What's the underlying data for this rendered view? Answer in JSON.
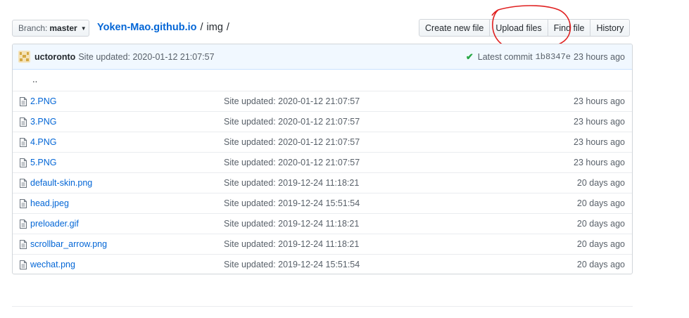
{
  "branch": {
    "label": "Branch:",
    "value": "master"
  },
  "breadcrumb": {
    "repo": "Yoken-Mao.github.io",
    "sep1": "/",
    "folder": "img",
    "sep2": "/"
  },
  "toolbar": {
    "create": "Create new file",
    "upload": "Upload files",
    "find": "Find file",
    "history": "History"
  },
  "commit": {
    "author": "uctoronto",
    "message": "Site updated: 2020-01-12 21:07:57",
    "latest_label": "Latest commit",
    "sha": "1b8347e",
    "age": "23 hours ago"
  },
  "updir": "..",
  "files": [
    {
      "name": "2.PNG",
      "message": "Site updated: 2020-01-12 21:07:57",
      "age": "23 hours ago"
    },
    {
      "name": "3.PNG",
      "message": "Site updated: 2020-01-12 21:07:57",
      "age": "23 hours ago"
    },
    {
      "name": "4.PNG",
      "message": "Site updated: 2020-01-12 21:07:57",
      "age": "23 hours ago"
    },
    {
      "name": "5.PNG",
      "message": "Site updated: 2020-01-12 21:07:57",
      "age": "23 hours ago"
    },
    {
      "name": "default-skin.png",
      "message": "Site updated: 2019-12-24 11:18:21",
      "age": "20 days ago"
    },
    {
      "name": "head.jpeg",
      "message": "Site updated: 2019-12-24 15:51:54",
      "age": "20 days ago"
    },
    {
      "name": "preloader.gif",
      "message": "Site updated: 2019-12-24 11:18:21",
      "age": "20 days ago"
    },
    {
      "name": "scrollbar_arrow.png",
      "message": "Site updated: 2019-12-24 11:18:21",
      "age": "20 days ago"
    },
    {
      "name": "wechat.png",
      "message": "Site updated: 2019-12-24 15:51:54",
      "age": "20 days ago"
    }
  ],
  "icons": {
    "file": "file-icon",
    "check": "check-icon",
    "caret": "caret-down-icon",
    "avatar": "avatar"
  },
  "colors": {
    "link": "#0366d6",
    "annotation": "#e02020",
    "success": "#28a745"
  }
}
